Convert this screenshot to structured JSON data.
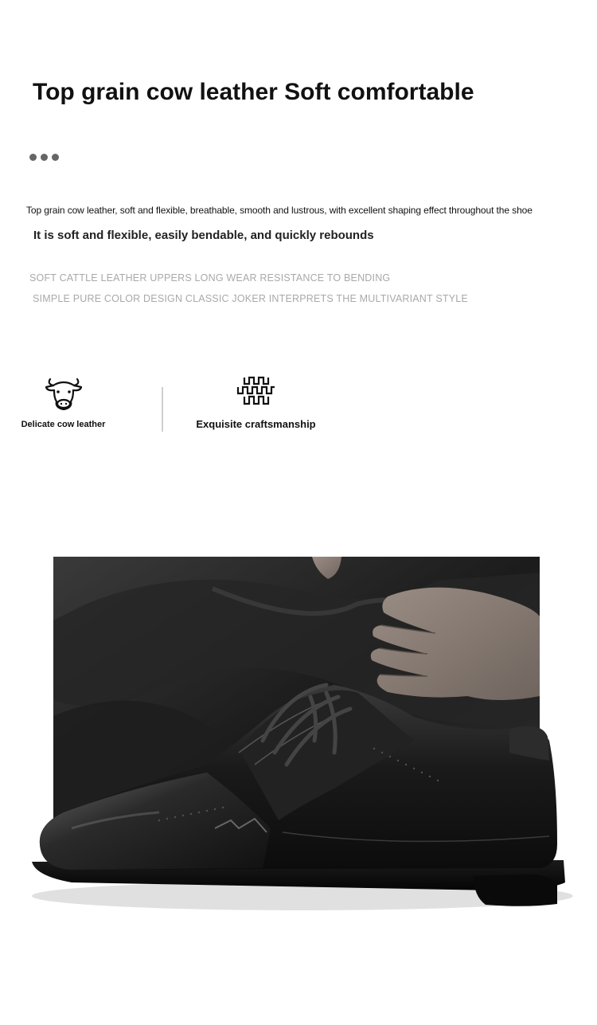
{
  "header": {
    "title": "Top grain cow leather Soft comfortable"
  },
  "description": {
    "line1": "Top grain cow leather, soft and flexible, breathable, smooth and lustrous, with excellent shaping effect throughout the shoe",
    "line2": "It is soft and flexible, easily bendable, and quickly rebounds"
  },
  "caps": {
    "line1": "SOFT CATTLE LEATHER UPPERS LONG WEAR RESISTANCE TO BENDING",
    "line2": "SIMPLE PURE COLOR DESIGN CLASSIC JOKER INTERPRETS THE MULTIVARIANT STYLE"
  },
  "features": [
    {
      "icon": "cow-head-icon",
      "label": "Delicate cow leather"
    },
    {
      "icon": "stitch-pattern-icon",
      "label": "Exquisite craftsmanship"
    }
  ],
  "colors": {
    "title": "#111111",
    "caps": "#a9a9a9",
    "dots": "#666666"
  }
}
